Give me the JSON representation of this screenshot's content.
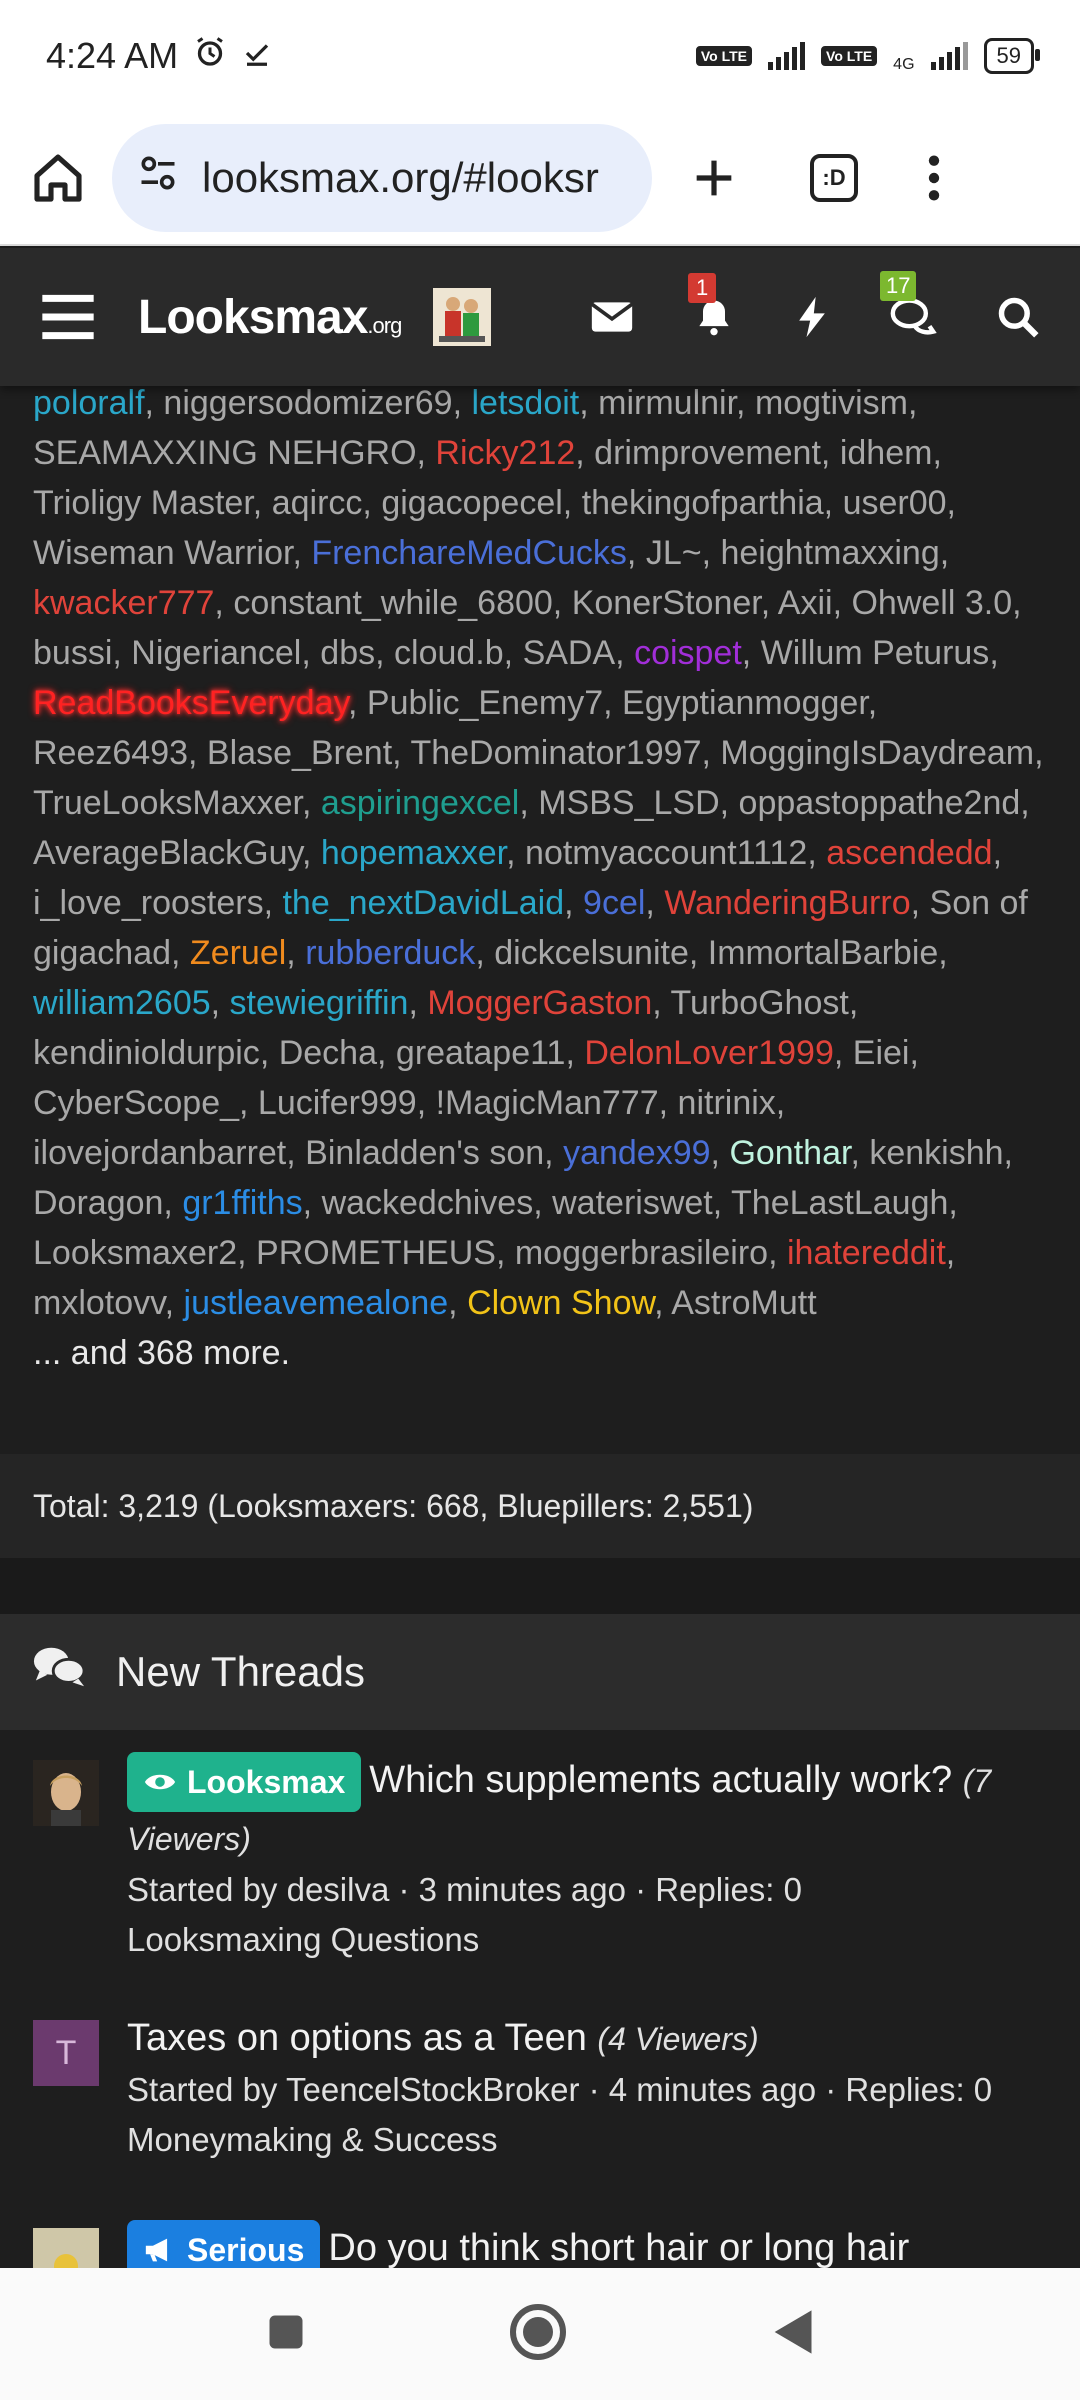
{
  "status_bar": {
    "time": "4:24 AM",
    "network": "4G",
    "battery": "59",
    "volte": "Vo LTE"
  },
  "browser": {
    "url": "looksmax.org/#looksr",
    "tabs_label": ":D"
  },
  "site": {
    "logo": "Looksmax",
    "logo_suffix": ".org",
    "alerts_count": "1",
    "conversations_count": "17"
  },
  "online_users": [
    {
      "name": "poloralf",
      "color": "cyan"
    },
    {
      "name": "niggersodomizer69",
      "color": "default"
    },
    {
      "name": "letsdoit",
      "color": "cyan"
    },
    {
      "name": "mirmulnir",
      "color": "default"
    },
    {
      "name": "mogtivism",
      "color": "default"
    },
    {
      "name": "SEAMAXXING NEHGRO",
      "color": "default"
    },
    {
      "name": "Ricky212",
      "color": "red"
    },
    {
      "name": "drimprovement",
      "color": "default"
    },
    {
      "name": "idhem",
      "color": "default"
    },
    {
      "name": "Trioligy Master",
      "color": "default"
    },
    {
      "name": "aqircc",
      "color": "default"
    },
    {
      "name": "gigacopecel",
      "color": "default"
    },
    {
      "name": "thekingofparthia",
      "color": "default"
    },
    {
      "name": "user00",
      "color": "default"
    },
    {
      "name": "Wiseman Warrior",
      "color": "default"
    },
    {
      "name": "FrenchareMedCucks",
      "color": "blue"
    },
    {
      "name": "JL~",
      "color": "default"
    },
    {
      "name": "heightmaxxing",
      "color": "default"
    },
    {
      "name": "kwacker777",
      "color": "red"
    },
    {
      "name": "constant_while_6800",
      "color": "default"
    },
    {
      "name": "KonerStoner",
      "color": "default"
    },
    {
      "name": "Axii",
      "color": "default"
    },
    {
      "name": "Ohwell 3.0",
      "color": "strike"
    },
    {
      "name": "bussi",
      "color": "default"
    },
    {
      "name": "Nigeriancel",
      "color": "default"
    },
    {
      "name": "dbs",
      "color": "default"
    },
    {
      "name": "cloud.b",
      "color": "default"
    },
    {
      "name": "SADA",
      "color": "default"
    },
    {
      "name": "coispet",
      "color": "purple"
    },
    {
      "name": "Willum Peturus",
      "color": "default"
    },
    {
      "name": "ReadBooksEveryday",
      "color": "glow"
    },
    {
      "name": "Public_Enemy7",
      "color": "default"
    },
    {
      "name": "Egyptianmogger",
      "color": "default"
    },
    {
      "name": "Reez6493",
      "color": "default"
    },
    {
      "name": "Blase_Brent",
      "color": "default"
    },
    {
      "name": "TheDominator1997",
      "color": "default"
    },
    {
      "name": "MoggingIsDaydream",
      "color": "default"
    },
    {
      "name": "TrueLooksMaxxer",
      "color": "default"
    },
    {
      "name": "aspiringexcel",
      "color": "teal"
    },
    {
      "name": "MSBS_LSD",
      "color": "default"
    },
    {
      "name": "oppastoppathe2nd",
      "color": "default"
    },
    {
      "name": "AverageBlackGuy",
      "color": "default"
    },
    {
      "name": "hopemaxxer",
      "color": "cyan"
    },
    {
      "name": "notmyaccount1112",
      "color": "default"
    },
    {
      "name": "ascendedd",
      "color": "red"
    },
    {
      "name": "i_love_roosters",
      "color": "default"
    },
    {
      "name": "the_nextDavidLaid",
      "color": "cyan"
    },
    {
      "name": "9cel",
      "color": "blue"
    },
    {
      "name": "WanderingBurro",
      "color": "red"
    },
    {
      "name": "Son of gigachad",
      "color": "default"
    },
    {
      "name": "Zeruel",
      "color": "orange"
    },
    {
      "name": "rubberduck",
      "color": "blue"
    },
    {
      "name": "dickcelsunite",
      "color": "default"
    },
    {
      "name": "ImmortalBarbie",
      "color": "default"
    },
    {
      "name": "william2605",
      "color": "cyan"
    },
    {
      "name": "stewiegriffin",
      "color": "cyan"
    },
    {
      "name": "MoggerGaston",
      "color": "red"
    },
    {
      "name": "TurboGhost",
      "color": "default"
    },
    {
      "name": "kendinioldurpic",
      "color": "default"
    },
    {
      "name": "Decha",
      "color": "default"
    },
    {
      "name": "greatape11",
      "color": "default"
    },
    {
      "name": "DelonLover1999",
      "color": "red"
    },
    {
      "name": "Eiei",
      "color": "default"
    },
    {
      "name": "CyberScope_",
      "color": "default"
    },
    {
      "name": "Lucifer999",
      "color": "default"
    },
    {
      "name": "!MagicMan777",
      "color": "default"
    },
    {
      "name": "nitrinix",
      "color": "default"
    },
    {
      "name": "ilovejordanbarret",
      "color": "default"
    },
    {
      "name": "Binladden's son",
      "color": "default"
    },
    {
      "name": "yandex99",
      "color": "blue"
    },
    {
      "name": "Gonthar",
      "color": "mint"
    },
    {
      "name": "kenkishh",
      "color": "default"
    },
    {
      "name": "Doragon",
      "color": "default"
    },
    {
      "name": "gr1ffiths",
      "color": "lblue"
    },
    {
      "name": "wackedchives",
      "color": "default"
    },
    {
      "name": "wateriswet",
      "color": "default"
    },
    {
      "name": "TheLastLaugh",
      "color": "default"
    },
    {
      "name": "Looksmaxer2",
      "color": "default"
    },
    {
      "name": "PROMETHEUS",
      "color": "default"
    },
    {
      "name": "moggerbrasileiro",
      "color": "default"
    },
    {
      "name": "ihatereddit",
      "color": "red"
    },
    {
      "name": "mxlotovv",
      "color": "default"
    },
    {
      "name": "justleavemealone",
      "color": "lblue"
    },
    {
      "name": "Clown Show",
      "color": "yellow"
    },
    {
      "name": "AstroMutt",
      "color": "default"
    }
  ],
  "online_more": "... and 368 more.",
  "total": "Total: 3,219 (Looksmaxers: 668, Bluepillers: 2,551)",
  "threads_heading": "New Threads",
  "threads": [
    {
      "prefix": "Looksmax",
      "title": "Which supplements actually work?",
      "viewers": "(7 Viewers)",
      "meta": "Started by desilva · 3 minutes ago · Replies: 0",
      "forum": "Looksmaxing Questions"
    },
    {
      "avatar_letter": "T",
      "title": "Taxes on options as a Teen",
      "viewers": "(4 Viewers)",
      "meta": "Started by TeencelStockBroker · 4 minutes ago · Replies: 0",
      "forum": "Moneymaking & Success"
    },
    {
      "prefix": "Serious",
      "title": "Do you think short hair or long hair"
    }
  ],
  "colors": {
    "default": "#a8a8a8",
    "cyan": "#2aa7c9",
    "red": "#e0433a",
    "blue": "#4a6fd8",
    "purple": "#a12ed8",
    "teal": "#1f9e8f",
    "orange": "#f08b1e",
    "mint": "#bff2de",
    "yellow": "#f2c318",
    "lblue": "#2b8de5"
  }
}
